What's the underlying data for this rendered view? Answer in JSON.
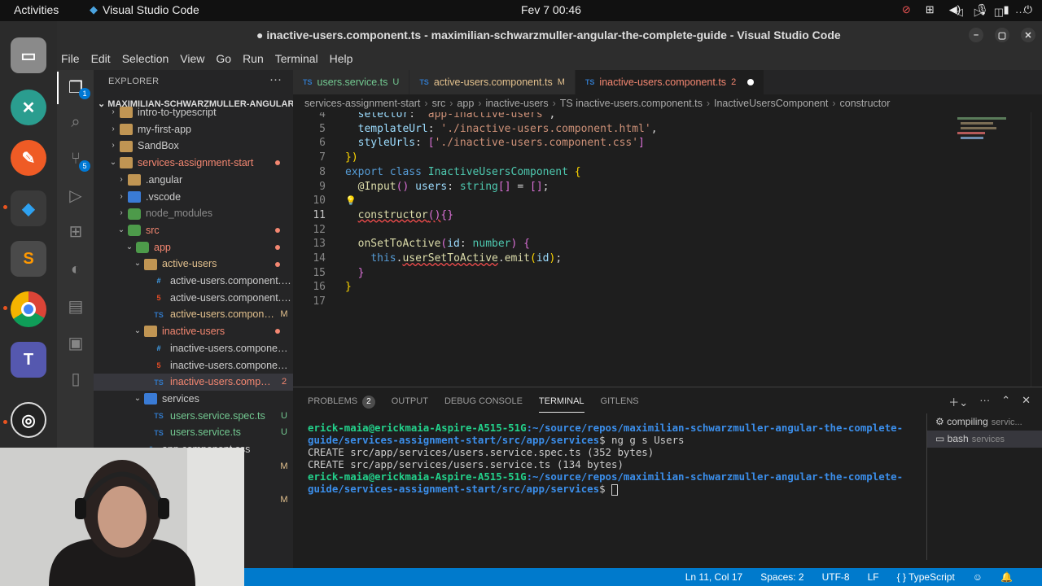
{
  "topbar": {
    "activities": "Activities",
    "app_name": "Visual Studio Code",
    "clock": "Fev 7  00:46"
  },
  "window": {
    "title": "● inactive-users.component.ts - maximilian-schwarzmuller-angular-the-complete-guide - Visual Studio Code"
  },
  "menu": [
    "File",
    "Edit",
    "Selection",
    "View",
    "Go",
    "Run",
    "Terminal",
    "Help"
  ],
  "activity_badges": {
    "explorer": "1",
    "scm": "5"
  },
  "explorer": {
    "header": "EXPLORER",
    "root": "MAXIMILIAN-SCHWARZMULLER-ANGULAR-...",
    "items": [
      {
        "name": "intro-to-typescript",
        "depth": 1,
        "kind": "folder",
        "chev": "›"
      },
      {
        "name": "my-first-app",
        "depth": 1,
        "kind": "folder",
        "chev": "›"
      },
      {
        "name": "SandBox",
        "depth": 1,
        "kind": "folder",
        "chev": "›"
      },
      {
        "name": "services-assignment-start",
        "depth": 1,
        "kind": "folder",
        "chev": "⌄",
        "dot": true,
        "color": "#f48771"
      },
      {
        "name": ".angular",
        "depth": 2,
        "kind": "folder",
        "chev": "›"
      },
      {
        "name": ".vscode",
        "depth": 2,
        "kind": "blue",
        "chev": "›"
      },
      {
        "name": "node_modules",
        "depth": 2,
        "kind": "green",
        "chev": "›",
        "color": "#8b8b8b"
      },
      {
        "name": "src",
        "depth": 2,
        "kind": "green",
        "chev": "⌄",
        "dot": true,
        "color": "#f48771"
      },
      {
        "name": "app",
        "depth": 3,
        "kind": "green",
        "chev": "⌄",
        "dot": true,
        "color": "#f48771"
      },
      {
        "name": "active-users",
        "depth": 4,
        "kind": "folder",
        "chev": "⌄",
        "dot": true,
        "color": "#e2c08d"
      },
      {
        "name": "active-users.component.css",
        "depth": 5,
        "kind": "css"
      },
      {
        "name": "active-users.component.html",
        "depth": 5,
        "kind": "html"
      },
      {
        "name": "active-users.compone...",
        "depth": 5,
        "kind": "ts",
        "badge": "M",
        "btype": "m",
        "color": "#e2c08d"
      },
      {
        "name": "inactive-users",
        "depth": 4,
        "kind": "folder",
        "chev": "⌄",
        "dot": true,
        "color": "#f48771"
      },
      {
        "name": "inactive-users.component.css",
        "depth": 5,
        "kind": "css"
      },
      {
        "name": "inactive-users.component....",
        "depth": 5,
        "kind": "html"
      },
      {
        "name": "inactive-users.compon...",
        "depth": 5,
        "kind": "ts",
        "badge": "2",
        "btype": "err",
        "color": "#f48771",
        "selected": true
      },
      {
        "name": "services",
        "depth": 4,
        "kind": "blue",
        "chev": "⌄"
      },
      {
        "name": "users.service.spec.ts",
        "depth": 5,
        "kind": "ts",
        "badge": "U",
        "btype": "u",
        "color": "#73c991"
      },
      {
        "name": "users.service.ts",
        "depth": 5,
        "kind": "ts",
        "badge": "U",
        "btype": "u",
        "color": "#73c991"
      },
      {
        "name": "app.component.css",
        "depth": 4,
        "kind": "css"
      },
      {
        "name": "al",
        "depth": 9,
        "kind": "none",
        "badge": "M",
        "btype": "m"
      },
      {
        "name": "c.ts",
        "depth": 9,
        "kind": "none"
      },
      {
        "name": "",
        "depth": 9,
        "kind": "none",
        "badge": "M",
        "btype": "m"
      }
    ]
  },
  "tabs": [
    {
      "label": "users.service.ts",
      "mark": "U",
      "icon": "TS",
      "color": "#73c991"
    },
    {
      "label": "active-users.component.ts",
      "mark": "M",
      "icon": "TS",
      "color": "#e2c08d"
    },
    {
      "label": "inactive-users.component.ts",
      "mark": "2",
      "icon": "TS",
      "color": "#f48771",
      "active": true
    }
  ],
  "breadcrumb": [
    "services-assignment-start",
    "src",
    "app",
    "inactive-users",
    "TS inactive-users.component.ts",
    "InactiveUsersComponent",
    "constructor"
  ],
  "editor": {
    "cursor_line": 11,
    "lines": [
      {
        "n": "4",
        "html": "  <span class='prop'>selector</span>: <span class='str'>'app-inactive-users'</span>,"
      },
      {
        "n": "5",
        "html": "  <span class='prop'>templateUrl</span>: <span class='str'>'./inactive-users.component.html'</span>,"
      },
      {
        "n": "6",
        "html": "  <span class='prop'>styleUrls</span>: <span class='brk2'>[</span><span class='str'>'./inactive-users.component.css'</span><span class='brk2'>]</span>"
      },
      {
        "n": "7",
        "html": "<span class='brk'>})</span>"
      },
      {
        "n": "8",
        "html": "<span class='kw'>export</span> <span class='kw'>class</span> <span class='cls'>InactiveUsersComponent</span> <span class='brk'>{</span>"
      },
      {
        "n": "9",
        "html": "  <span class='dec'>@Input</span><span class='brk2'>()</span> <span class='prop'>users</span>: <span class='typ'>string</span><span class='brk2'>[]</span> = <span class='brk2'>[]</span>;"
      },
      {
        "n": "10",
        "html": ""
      },
      {
        "n": "11",
        "html": "  <span class='fn squig'>constructor</span><span class='brk2 squig'>()</span><span class='brk2'>{}</span>"
      },
      {
        "n": "12",
        "html": ""
      },
      {
        "n": "13",
        "html": "  <span class='fn'>onSetToActive</span><span class='brk2'>(</span><span class='prop'>id</span>: <span class='typ'>number</span><span class='brk2'>)</span> <span class='brk2'>{</span>"
      },
      {
        "n": "14",
        "html": "    <span class='kw'>this</span>.<span class='fn squig'>userSetToActive</span>.<span class='fn'>emit</span><span class='brk'>(</span><span class='prop'>id</span><span class='brk'>)</span>;"
      },
      {
        "n": "15",
        "html": "  <span class='brk2'>}</span>"
      },
      {
        "n": "16",
        "html": "<span class='brk'>}</span>"
      },
      {
        "n": "17",
        "html": ""
      }
    ]
  },
  "panel": {
    "tabs": [
      {
        "label": "PROBLEMS",
        "badge": "2"
      },
      {
        "label": "OUTPUT"
      },
      {
        "label": "DEBUG CONSOLE"
      },
      {
        "label": "TERMINAL",
        "active": true
      },
      {
        "label": "GITLENS"
      }
    ],
    "terminal": [
      {
        "prompt": "erick-maia@erickmaia-Aspire-A515-51G",
        "path": ":~/source/repos/maximilian-schwarzmuller-angular-the-complete-"
      },
      {
        "path": "guide/services-assignment-start/src/app/services",
        "cmd": "$ ng g s Users"
      },
      {
        "text": "CREATE src/app/services/users.service.spec.ts (352 bytes)"
      },
      {
        "text": "CREATE src/app/services/users.service.ts (134 bytes)"
      },
      {
        "prompt": "erick-maia@erickmaia-Aspire-A515-51G",
        "path": ":~/source/repos/maximilian-schwarzmuller-angular-the-complete-"
      },
      {
        "path": "guide/services-assignment-start/src/app/services",
        "cmd": "$ ",
        "cursor": true
      }
    ],
    "terminals_list": [
      {
        "name": "compiling",
        "sub": "servic..."
      },
      {
        "name": "bash",
        "sub": "services",
        "selected": true
      }
    ]
  },
  "status": {
    "position": "Ln 11, Col 17",
    "spaces": "Spaces: 2",
    "encoding": "UTF-8",
    "eol": "LF",
    "language": "{ } TypeScript"
  }
}
